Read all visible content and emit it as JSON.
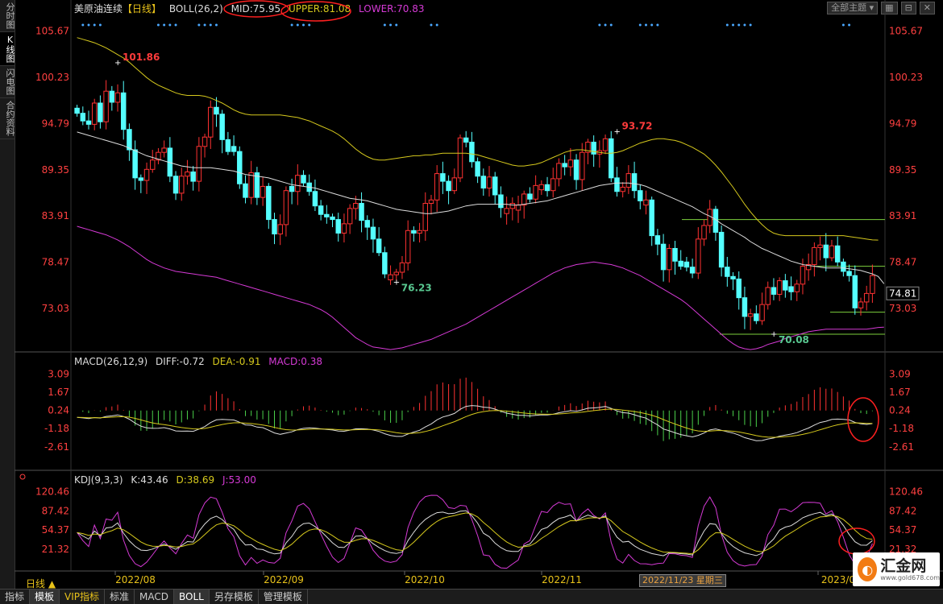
{
  "sidebar": {
    "tabs": [
      "分时图",
      "K线图",
      "闪电图",
      "合约资料"
    ],
    "active_index": 1
  },
  "header": {
    "symbol": "美原油连续",
    "period": "【日线】",
    "boll_label": "BOLL(26,2)",
    "mid": "MID:75.95",
    "upper": "UPPER:81.08",
    "lower": "LOWER:70.83"
  },
  "top_buttons": {
    "theme": "全部主题"
  },
  "colors": {
    "up": "#ff3232",
    "down": "#54ffff",
    "mid": "#dddddd",
    "upper": "#d6c91d",
    "lower": "#d63ad6",
    "hline": "#7dd13d",
    "annotation": "#ff2020",
    "price_axis": "#ff4040"
  },
  "current_price": "74.81",
  "chart_data": [
    {
      "type": "candlestick",
      "name": "美原油连续",
      "y_ticks": [
        "105.67",
        "100.23",
        "94.79",
        "89.35",
        "83.91",
        "78.47",
        "73.03"
      ],
      "ylim": [
        68.3,
        108.0
      ],
      "x_ticks": [
        "2022/08",
        "2022/09",
        "2022/10",
        "2022/11",
        "2023/0"
      ],
      "annotations": [
        {
          "label": "101.86",
          "price": 101.86,
          "index": 7
        },
        {
          "label": "76.23",
          "price": 76.23,
          "index": 55
        },
        {
          "label": "93.72",
          "price": 93.72,
          "index": 93
        },
        {
          "label": "70.08",
          "price": 70.08,
          "index": 120
        }
      ],
      "horizontal_lines": [
        83.5,
        78.0,
        72.6,
        70.0
      ],
      "closes": [
        96.0,
        95.1,
        94.7,
        97.2,
        95.0,
        98.6,
        97.3,
        98.4,
        94.1,
        91.7,
        88.4,
        88.1,
        89.4,
        90.5,
        91.4,
        91.9,
        88.6,
        86.6,
        88.6,
        89.1,
        88.0,
        92.1,
        93.2,
        96.7,
        95.9,
        92.9,
        91.5,
        91.5,
        87.7,
        86.1,
        89.0,
        86.1,
        87.4,
        83.5,
        81.8,
        82.9,
        86.9,
        86.8,
        88.7,
        87.8,
        86.8,
        85.1,
        84.1,
        83.8,
        83.5,
        81.9,
        83.0,
        84.8,
        85.4,
        83.4,
        82.6,
        81.2,
        79.6,
        77.1,
        77.0,
        77.3,
        78.4,
        82.2,
        81.9,
        82.2,
        85.4,
        85.8,
        88.9,
        88.0,
        86.9,
        88.4,
        93.1,
        92.6,
        90.3,
        88.6,
        87.2,
        88.5,
        86.4,
        84.9,
        84.8,
        85.4,
        85.2,
        86.5,
        85.9,
        87.5,
        87.6,
        86.9,
        88.3,
        90.1,
        89.7,
        90.5,
        88.2,
        91.4,
        92.6,
        91.2,
        91.6,
        93.0,
        88.4,
        86.8,
        87.3,
        88.9,
        86.9,
        85.7,
        85.8,
        81.6,
        80.6,
        77.6,
        80.1,
        78.6,
        78.0,
        77.9,
        77.2,
        81.2,
        82.8,
        84.7,
        82.0,
        77.9,
        76.8,
        76.5,
        74.3,
        72.1,
        72.4,
        71.6,
        73.5,
        75.5,
        74.7,
        76.3,
        75.2,
        75.0,
        75.9,
        78.0,
        78.2,
        80.2,
        80.5,
        79.0,
        80.4,
        78.5,
        77.4,
        76.9,
        73.1,
        73.8,
        74.8,
        76.9
      ],
      "mid": [
        93.8,
        93.6,
        93.4,
        93.2,
        93.0,
        92.8,
        92.6,
        92.4,
        92.2,
        91.9,
        91.6,
        91.3,
        91.0,
        90.8,
        90.6,
        90.4,
        90.2,
        90.0,
        89.8,
        89.7,
        89.6,
        89.6,
        89.6,
        89.6,
        89.5,
        89.4,
        89.3,
        89.2,
        89.0,
        88.8,
        88.7,
        88.6,
        88.5,
        88.4,
        88.2,
        88.0,
        87.8,
        87.6,
        87.5,
        87.4,
        87.3,
        87.2,
        87.0,
        86.8,
        86.6,
        86.4,
        86.2,
        86.0,
        85.9,
        85.8,
        85.7,
        85.5,
        85.3,
        85.1,
        84.9,
        84.7,
        84.6,
        84.5,
        84.4,
        84.3,
        84.2,
        84.2,
        84.3,
        84.4,
        84.5,
        84.7,
        84.9,
        85.1,
        85.2,
        85.3,
        85.3,
        85.3,
        85.3,
        85.3,
        85.3,
        85.2,
        85.2,
        85.3,
        85.4,
        85.5,
        85.6,
        85.7,
        85.9,
        86.1,
        86.3,
        86.5,
        86.7,
        86.9,
        87.1,
        87.3,
        87.5,
        87.6,
        87.7,
        87.8,
        87.8,
        87.8,
        87.7,
        87.6,
        87.4,
        87.1,
        86.8,
        86.5,
        86.2,
        85.9,
        85.6,
        85.3,
        85.0,
        84.6,
        84.2,
        83.9,
        83.5,
        83.0,
        82.6,
        82.2,
        81.8,
        81.4,
        80.9,
        80.5,
        80.1,
        79.8,
        79.5,
        79.2,
        78.9,
        78.6,
        78.4,
        78.2,
        78.1,
        78.0,
        77.9,
        77.8,
        77.8,
        77.8,
        77.8,
        77.7,
        77.6,
        77.5,
        77.3,
        77.1,
        76.8,
        75.95
      ],
      "upper": [
        104.9,
        104.7,
        104.5,
        104.3,
        104.0,
        103.7,
        103.3,
        102.9,
        102.5,
        102.0,
        101.4,
        100.8,
        100.2,
        99.7,
        99.3,
        99.0,
        98.7,
        98.4,
        98.2,
        98.1,
        98.1,
        98.1,
        98.0,
        97.8,
        97.5,
        97.2,
        96.8,
        96.4,
        96.1,
        95.9,
        95.8,
        95.8,
        95.8,
        95.8,
        95.8,
        95.8,
        95.7,
        95.6,
        95.5,
        95.3,
        95.1,
        94.8,
        94.5,
        94.2,
        93.9,
        93.5,
        93.0,
        92.4,
        91.8,
        91.3,
        90.9,
        90.6,
        90.5,
        90.5,
        90.6,
        90.7,
        90.8,
        90.9,
        91.0,
        91.0,
        91.1,
        91.1,
        91.2,
        91.3,
        91.3,
        91.3,
        91.3,
        91.3,
        91.2,
        91.1,
        90.9,
        90.7,
        90.5,
        90.3,
        90.1,
        89.9,
        89.8,
        89.8,
        89.9,
        90.0,
        90.2,
        90.5,
        90.8,
        91.1,
        91.4,
        91.6,
        91.7,
        91.7,
        91.6,
        91.5,
        91.4,
        91.3,
        91.3,
        91.4,
        91.6,
        91.9,
        92.2,
        92.5,
        92.7,
        92.9,
        93.0,
        93.0,
        92.9,
        92.8,
        92.6,
        92.3,
        92.0,
        91.6,
        91.2,
        90.6,
        89.9,
        89.1,
        88.2,
        87.3,
        86.3,
        85.3,
        84.4,
        83.6,
        82.9,
        82.3,
        81.9,
        81.7,
        81.6,
        81.6,
        81.6,
        81.6,
        81.6,
        81.6,
        81.6,
        81.6,
        81.6,
        81.6,
        81.6,
        81.5,
        81.4,
        81.3,
        81.2,
        81.1,
        81.08
      ],
      "lower": [
        82.7,
        82.5,
        82.3,
        82.1,
        81.9,
        81.7,
        81.4,
        81.1,
        80.7,
        80.3,
        79.8,
        79.3,
        78.8,
        78.4,
        78.1,
        77.8,
        77.6,
        77.4,
        77.3,
        77.2,
        77.1,
        77.0,
        76.9,
        76.8,
        76.7,
        76.5,
        76.3,
        76.1,
        75.9,
        75.7,
        75.5,
        75.3,
        75.1,
        74.9,
        74.7,
        74.5,
        74.3,
        74.1,
        73.9,
        73.7,
        73.5,
        73.2,
        72.9,
        72.5,
        72.0,
        71.4,
        70.8,
        70.2,
        69.6,
        69.2,
        68.8,
        68.5,
        68.4,
        68.3,
        68.2,
        68.3,
        68.4,
        68.6,
        68.8,
        69.0,
        69.2,
        69.4,
        69.7,
        70.0,
        70.3,
        70.6,
        70.9,
        71.2,
        71.6,
        72.0,
        72.4,
        72.8,
        73.2,
        73.6,
        74.0,
        74.4,
        74.8,
        75.2,
        75.6,
        76.0,
        76.4,
        76.8,
        77.2,
        77.5,
        77.8,
        78.0,
        78.2,
        78.3,
        78.4,
        78.5,
        78.4,
        78.3,
        78.2,
        78.0,
        77.8,
        77.5,
        77.2,
        76.9,
        76.5,
        76.1,
        75.7,
        75.3,
        74.9,
        74.5,
        74.1,
        73.6,
        73.0,
        72.4,
        71.8,
        71.2,
        70.6,
        70.0,
        69.4,
        68.9,
        68.5,
        68.3,
        68.2,
        68.3,
        68.5,
        68.8,
        69.0,
        69.2,
        69.5,
        69.7,
        69.9,
        70.1,
        70.3,
        70.4,
        70.5,
        70.6,
        70.6,
        70.6,
        70.6,
        70.6,
        70.6,
        70.6,
        70.6,
        70.7,
        70.8,
        70.83
      ]
    },
    {
      "type": "macd",
      "label": "MACD(26,12,9)",
      "diff_text": "DIFF:-0.72",
      "dea_text": "DEA:-0.91",
      "macd_text": "MACD:0.38",
      "y_ticks": [
        "3.09",
        "1.67",
        "0.24",
        "-1.18",
        "-2.61"
      ],
      "ylim": [
        -4.2,
        3.7
      ]
    },
    {
      "type": "kdj",
      "label": "KDJ(9,3,3)",
      "k_text": "K:43.46",
      "d_text": "D:38.69",
      "j_text": "J:53.00",
      "y_ticks": [
        "120.46",
        "87.42",
        "54.37",
        "21.32"
      ],
      "ylim": [
        -15,
        135
      ]
    }
  ],
  "bottom_tabs": [
    "指标",
    "模板",
    "VIP指标",
    "标准",
    "MACD",
    "BOLL",
    "另存模板",
    "管理模板"
  ],
  "bottom_active": [
    1,
    5
  ],
  "period_tag": "日线 ▲",
  "date_tag": "2022/11/23 星期三",
  "logo": {
    "name": "汇金网",
    "url": "www.gold678.com"
  }
}
